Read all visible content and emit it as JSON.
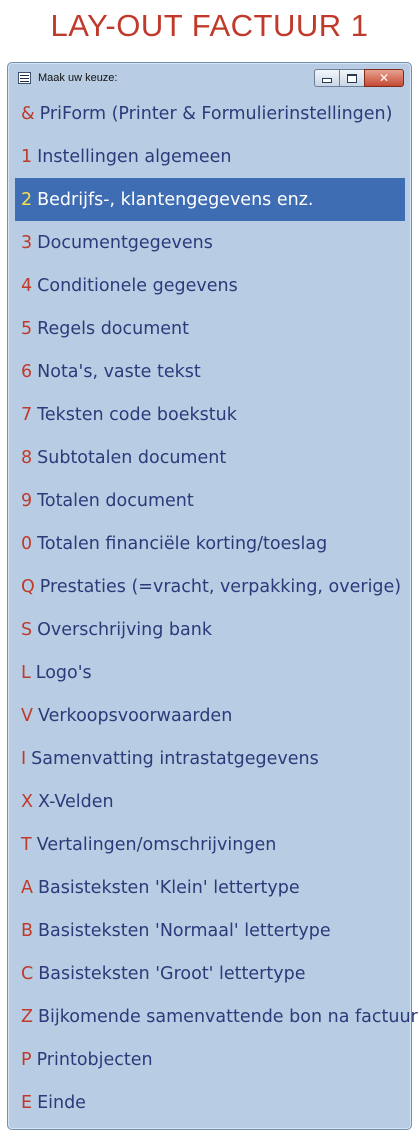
{
  "page_title": "LAY-OUT FACTUUR 1",
  "window": {
    "title": "Maak uw keuze:",
    "icons": {
      "app": "window-menu-icon",
      "minimize": "minimize-icon",
      "maximize": "maximize-icon",
      "close": "close-icon"
    },
    "close_glyph": "✕"
  },
  "colors": {
    "title_red": "#c0392b",
    "window_bg": "#b8cde3",
    "item_text": "#2c3a7a",
    "key_red": "#c0392b",
    "selected_bg": "#3f6db3",
    "selected_key": "#f4e04d"
  },
  "menu": {
    "items": [
      {
        "key": "&",
        "label": "PriForm (Printer & Formulierinstellingen)",
        "selected": false
      },
      {
        "key": "1",
        "label": "Instellingen algemeen",
        "selected": false
      },
      {
        "key": "2",
        "label": "Bedrijfs-, klantengegevens enz.",
        "selected": true
      },
      {
        "key": "3",
        "label": "Documentgegevens",
        "selected": false
      },
      {
        "key": "4",
        "label": "Conditionele gegevens",
        "selected": false
      },
      {
        "key": "5",
        "label": "Regels document",
        "selected": false
      },
      {
        "key": "6",
        "label": "Nota's, vaste tekst",
        "selected": false
      },
      {
        "key": "7",
        "label": "Teksten code boekstuk",
        "selected": false
      },
      {
        "key": "8",
        "label": "Subtotalen document",
        "selected": false
      },
      {
        "key": "9",
        "label": "Totalen document",
        "selected": false
      },
      {
        "key": "0",
        "label": "Totalen financiële korting/toeslag",
        "selected": false
      },
      {
        "key": "Q",
        "label": "Prestaties (=vracht, verpakking, overige)",
        "selected": false
      },
      {
        "key": "S",
        "label": "Overschrijving bank",
        "selected": false
      },
      {
        "key": "L",
        "label": "Logo's",
        "selected": false
      },
      {
        "key": "V",
        "label": "Verkoopsvoorwaarden",
        "selected": false
      },
      {
        "key": "I",
        "label": "Samenvatting intrastatgegevens",
        "selected": false
      },
      {
        "key": "X",
        "label": "X-Velden",
        "selected": false
      },
      {
        "key": "T",
        "label": "Vertalingen/omschrijvingen",
        "selected": false
      },
      {
        "key": "A",
        "label": "Basisteksten 'Klein' lettertype",
        "selected": false
      },
      {
        "key": "B",
        "label": "Basisteksten 'Normaal' lettertype",
        "selected": false
      },
      {
        "key": "C",
        "label": "Basisteksten 'Groot' lettertype",
        "selected": false
      },
      {
        "key": "Z",
        "label": "Bijkomende samenvattende bon na factuur",
        "selected": false
      },
      {
        "key": "P",
        "label": "Printobjecten",
        "selected": false
      },
      {
        "key": "E",
        "label": "Einde",
        "selected": false
      }
    ]
  }
}
